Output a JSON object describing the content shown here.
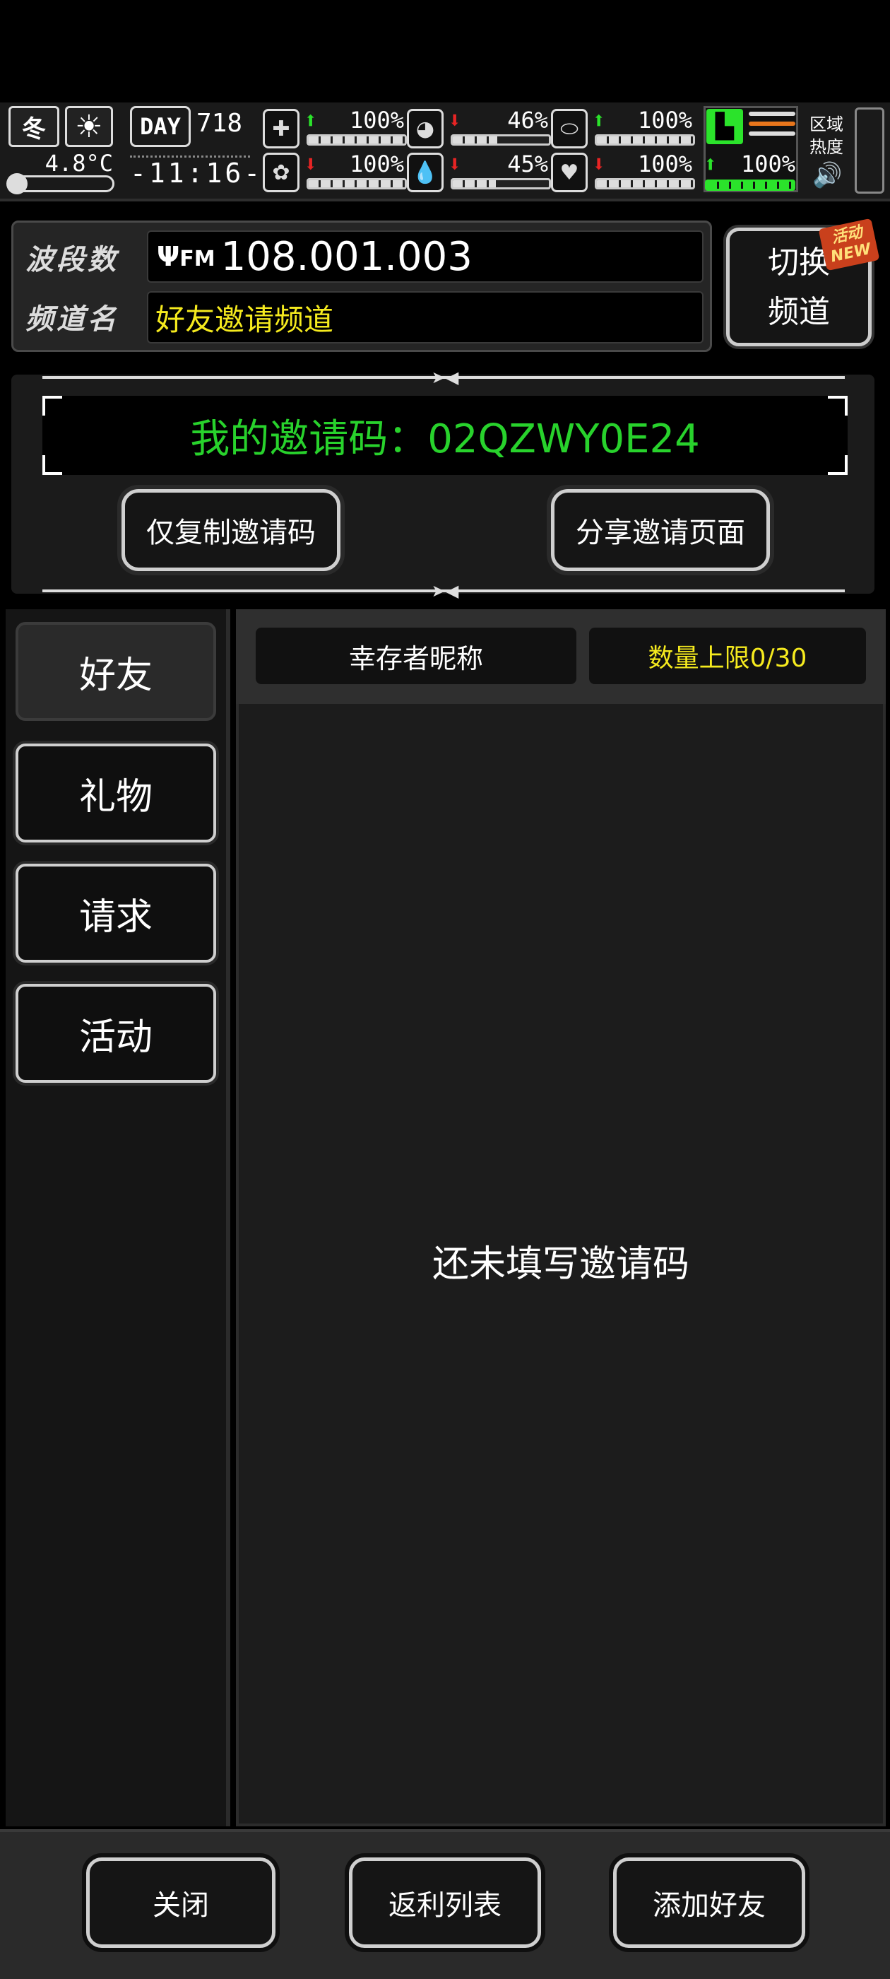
{
  "status": {
    "season": "冬",
    "weather_icon": "sun-icon",
    "temperature": "4.8°C",
    "day_label": "DAY",
    "day_number": "718",
    "clock": "-11:16-",
    "stats": [
      {
        "name": "health",
        "icon": "medkit-icon",
        "trend": "up",
        "value": "100%",
        "level": 1.0
      },
      {
        "name": "hunger",
        "icon": "stomach-icon",
        "trend": "down",
        "value": "46%",
        "level": 0.46
      },
      {
        "name": "medicine",
        "icon": "pill-icon",
        "trend": "up",
        "value": "100%",
        "level": 1.0
      },
      {
        "name": "mental",
        "icon": "brain-icon",
        "trend": "down",
        "value": "100%",
        "level": 1.0
      },
      {
        "name": "thirst",
        "icon": "water-drop-icon",
        "trend": "down",
        "value": "45%",
        "level": 0.45
      },
      {
        "name": "heart",
        "icon": "heart-icon",
        "trend": "down",
        "value": "100%",
        "level": 1.0
      }
    ],
    "stamina": {
      "icon": "boot-icon",
      "trend": "up",
      "value": "100%",
      "level": 1.0
    },
    "heat_label": "区域热度",
    "sound_icon": "speaker-icon"
  },
  "channel": {
    "band_label": "波段数",
    "fm_label": "FM",
    "frequency": "108.001.003",
    "name_label": "频道名",
    "channel_name": "好友邀请频道",
    "switch_label_1": "切换",
    "switch_label_2": "频道",
    "badge_line_1": "活动",
    "badge_line_2": "NEW"
  },
  "invite": {
    "code_text": "我的邀请码：02QZWY0E24",
    "copy_button": "仅复制邀请码",
    "share_button": "分享邀请页面"
  },
  "tabs": [
    {
      "label": "好友",
      "active": true
    },
    {
      "label": "礼物",
      "active": false
    },
    {
      "label": "请求",
      "active": false
    },
    {
      "label": "活动",
      "active": false
    }
  ],
  "list": {
    "col_nickname": "幸存者昵称",
    "col_limit": "数量上限0/30",
    "empty_message": "还未填写邀请码"
  },
  "footer": {
    "close": "关闭",
    "rebate_list": "返利列表",
    "add_friend": "添加好友"
  },
  "colors": {
    "accent_green": "#28d22c",
    "accent_yellow": "#f5ea1e",
    "up_green": "#2be32b",
    "down_red": "#e82424"
  }
}
